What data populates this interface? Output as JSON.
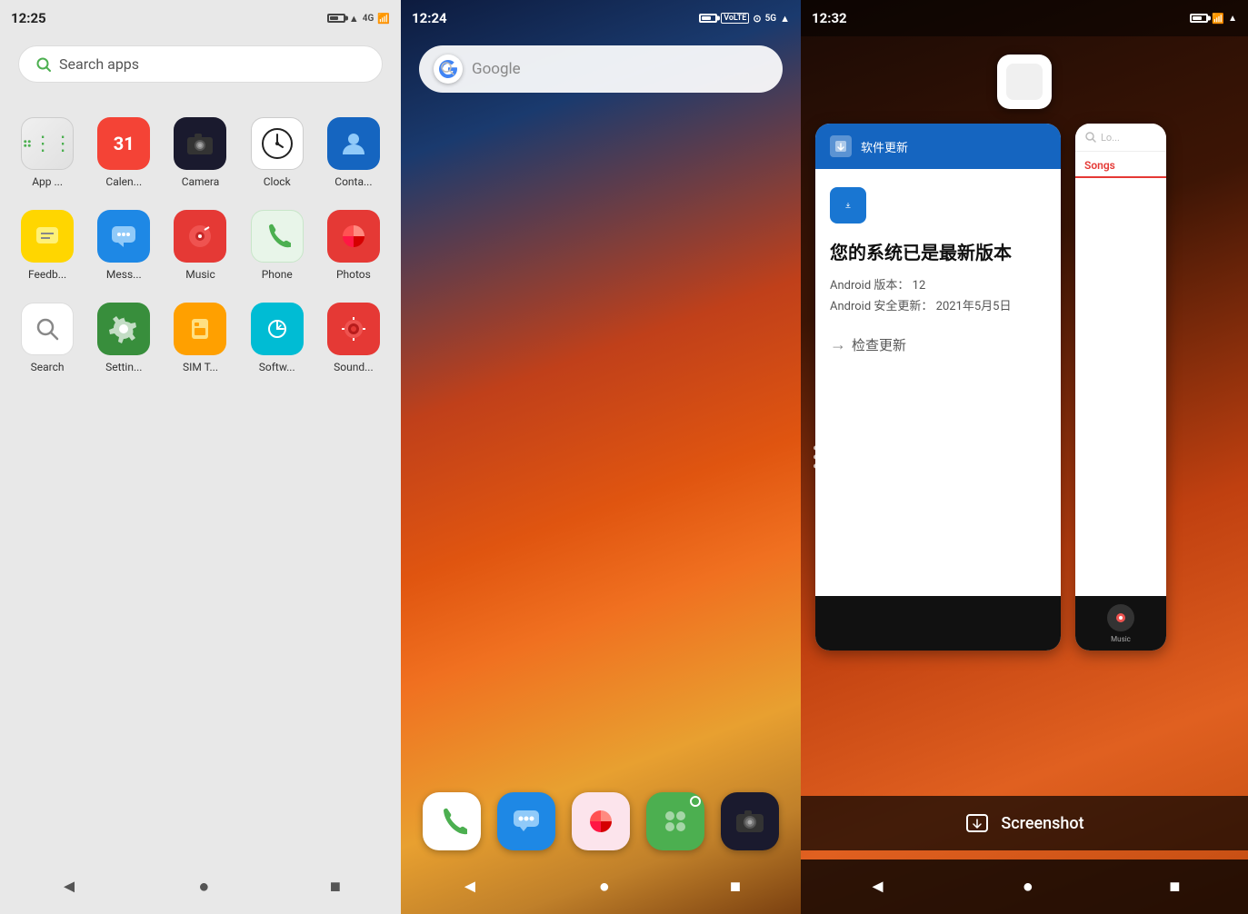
{
  "panel1": {
    "time": "12:25",
    "search_placeholder": "Search apps",
    "apps": [
      {
        "id": "appvault",
        "label": "App ...",
        "icon_class": "icon-appvault",
        "icon_char": ""
      },
      {
        "id": "calendar",
        "label": "Calen...",
        "icon_class": "icon-calendar",
        "icon_char": "31"
      },
      {
        "id": "camera",
        "label": "Camera",
        "icon_class": "icon-camera",
        "icon_char": "📷"
      },
      {
        "id": "clock",
        "label": "Clock",
        "icon_class": "icon-clock",
        "icon_char": "🕐"
      },
      {
        "id": "contacts",
        "label": "Conta...",
        "icon_class": "icon-contacts",
        "icon_char": "👤"
      },
      {
        "id": "feedback",
        "label": "Feedb...",
        "icon_class": "icon-feedback",
        "icon_char": "💬"
      },
      {
        "id": "messages",
        "label": "Mess...",
        "icon_class": "icon-messages",
        "icon_char": "💬"
      },
      {
        "id": "music",
        "label": "Music",
        "icon_class": "icon-music",
        "icon_char": "🎵"
      },
      {
        "id": "phone",
        "label": "Phone",
        "icon_class": "icon-phone",
        "icon_char": "📞"
      },
      {
        "id": "photos",
        "label": "Photos",
        "icon_class": "icon-photos",
        "icon_char": "🖼"
      },
      {
        "id": "search",
        "label": "Search",
        "icon_class": "icon-search-app",
        "icon_char": "🔍"
      },
      {
        "id": "settings",
        "label": "Settin...",
        "icon_class": "icon-settings",
        "icon_char": "⚙"
      },
      {
        "id": "simt",
        "label": "SIM T...",
        "icon_class": "icon-simt",
        "icon_char": ""
      },
      {
        "id": "software",
        "label": "Softw...",
        "icon_class": "icon-software",
        "icon_char": ""
      },
      {
        "id": "sound",
        "label": "Sound...",
        "icon_class": "icon-sound",
        "icon_char": ""
      }
    ],
    "nav": {
      "back": "◄",
      "home": "●",
      "recents": "■"
    }
  },
  "panel2": {
    "time": "12:24",
    "search_placeholder": "Google",
    "dock_apps": [
      {
        "id": "phone",
        "color": "#fff",
        "icon": "📞"
      },
      {
        "id": "messages",
        "color": "#1E88E5",
        "icon": "💬"
      },
      {
        "id": "photos",
        "color": "#e53935",
        "icon": "🖼"
      },
      {
        "id": "appvault",
        "color": "#4CAF50",
        "icon": "⋮⋮",
        "badge": true
      },
      {
        "id": "camera",
        "color": "#1a1a2e",
        "icon": "📷"
      }
    ],
    "nav": {
      "back": "◄",
      "home": "●",
      "recents": "■"
    }
  },
  "panel3": {
    "time": "12:32",
    "card1": {
      "header_color": "#1565C0",
      "title": "您的系统已是最新版本",
      "android_version_label": "Android 版本：",
      "android_version": "12",
      "security_update_label": "Android 安全更新：",
      "security_update": "2021年5月5日",
      "check_update": "检查更新"
    },
    "card2": {
      "search_placeholder": "Lo...",
      "tab_label": "Songs"
    },
    "screenshot_label": "Screenshot",
    "nav": {
      "back": "◄",
      "home": "●",
      "recents": "■"
    }
  }
}
